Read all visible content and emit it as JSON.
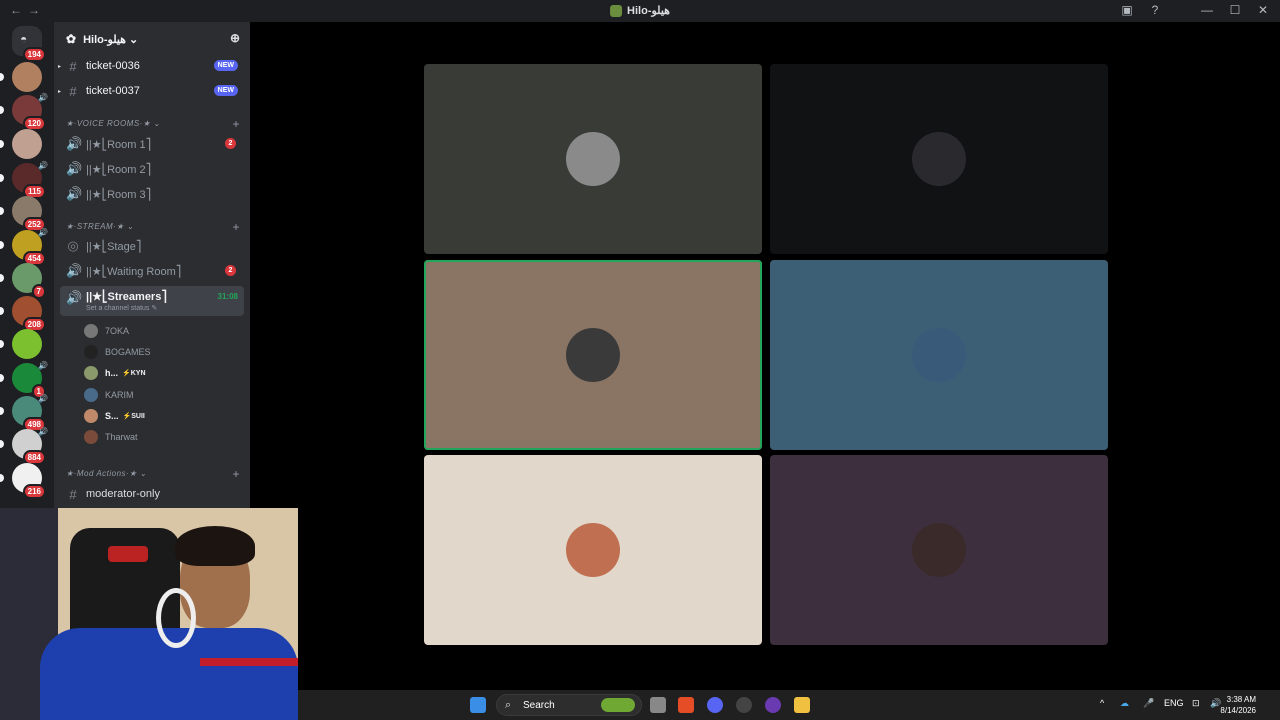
{
  "window": {
    "title": "Hilo-هيلو",
    "nav_back": "←",
    "nav_forward": "→",
    "controls": [
      "▣",
      "?",
      "—",
      "☐",
      "✕"
    ]
  },
  "rail": {
    "home_badge": "194",
    "servers": [
      {
        "badge": "",
        "color": "#b08060"
      },
      {
        "badge": "120",
        "color": "#7a3a3a",
        "speaker": "🔊"
      },
      {
        "badge": "",
        "color": "#c0a090"
      },
      {
        "badge": "115",
        "color": "#5a2a2a",
        "speaker": "🔊"
      },
      {
        "badge": "252",
        "color": "#8a7a6a"
      },
      {
        "badge": "454",
        "color": "#c0a020",
        "speaker": "🔊"
      },
      {
        "badge": "7",
        "color": "#6a9a6a"
      },
      {
        "badge": "208",
        "color": "#a05030"
      },
      {
        "badge": "",
        "color": "#7cc030"
      },
      {
        "badge": "1",
        "color": "#1a8a3a",
        "speaker": "🔊"
      },
      {
        "badge": "498",
        "color": "#4a8a7a",
        "speaker": "🔊"
      },
      {
        "badge": "884",
        "color": "#d0d0d0",
        "speaker": "🔊"
      },
      {
        "badge": "216",
        "color": "#f0f0f0"
      }
    ]
  },
  "server": {
    "name": "Hilo-هيلو",
    "chevron": "⌄"
  },
  "channels": {
    "ticket1": {
      "name": "ticket-0036",
      "badge": "NEW"
    },
    "ticket2": {
      "name": "ticket-0037",
      "badge": "NEW"
    },
    "voice_category": "★·VOICE ROOMS·★ ⌄",
    "room1": {
      "name": "||★⎣Room 1⎤",
      "count": "2"
    },
    "room2": {
      "name": "||★⎣Room 2⎤"
    },
    "room3": {
      "name": "||★⎣Room 3⎤"
    },
    "stream_category": "★·STREAM·★ ⌄",
    "stage": {
      "name": "||★⎣Stage⎤"
    },
    "waiting": {
      "name": "||★⎣Waiting Room⎤",
      "count": "2"
    },
    "streamers": {
      "name": "||★⎣Streamers⎤",
      "timer": "31:08",
      "status": "Set a channel status ✎"
    },
    "members": [
      {
        "name": "7OKA",
        "tag": "",
        "color": "#777"
      },
      {
        "name": "BOGAMES",
        "tag": "",
        "color": "#222"
      },
      {
        "name": "h...",
        "tag": "⚡KYN",
        "color": "#8a9a6a"
      },
      {
        "name": "KARIM",
        "tag": "",
        "color": "#4a6a8a"
      },
      {
        "name": "S...",
        "tag": "⚡SUII",
        "color": "#c08a6a"
      },
      {
        "name": "Tharwat",
        "tag": "",
        "color": "#7a4a3a"
      }
    ],
    "mod_category": "★·Mod Actions·★ ⌄",
    "moderator": {
      "name": "moderator-only"
    }
  },
  "tiles": [
    {
      "bg": "#383b36",
      "avatar": "#8a8a8a"
    },
    {
      "bg": "#111214",
      "avatar": "#2a2a2e"
    },
    {
      "bg": "#8a7565",
      "avatar": "#3a3a3a"
    },
    {
      "bg": "#3c5f75",
      "avatar": "#3a5a7a"
    },
    {
      "bg": "#e1d7cb",
      "avatar": "#c07050"
    },
    {
      "bg": "#3e2f3e",
      "avatar": "#3a2a2a"
    }
  ],
  "taskbar": {
    "search": "Search",
    "lang": "ENG",
    "time": "3:38 AM",
    "date": "8/14/2026"
  }
}
